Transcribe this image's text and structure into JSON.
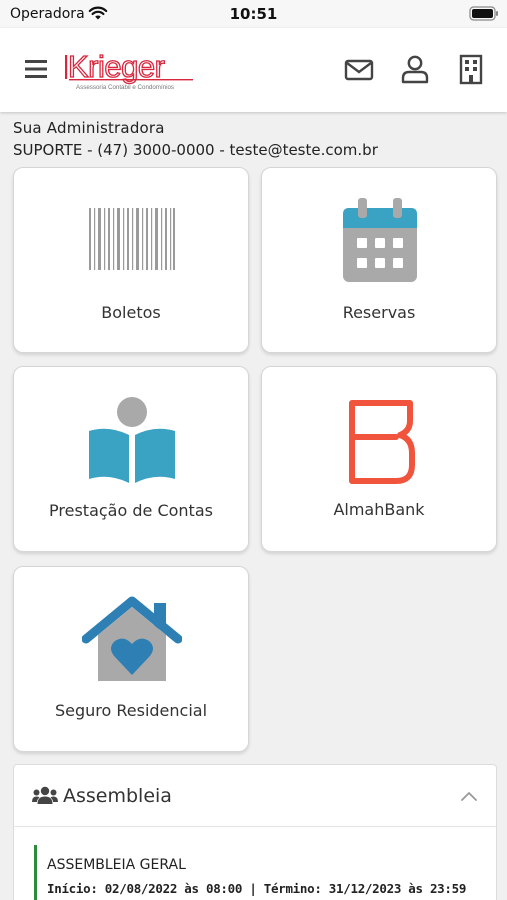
{
  "status_bar": {
    "carrier": "Operadora",
    "time": "10:51"
  },
  "header": {
    "logo_text": "Krieger",
    "logo_tagline": "Assessoria Contábil e Condomínios",
    "icons": [
      "menu-icon",
      "mail-icon",
      "user-icon",
      "building-icon"
    ],
    "brand_color": "#d7263d"
  },
  "admin": {
    "title": "Sua Administradora",
    "contact": "SUPORTE - (47) 3000-0000 - teste@teste.com.br"
  },
  "cards": [
    {
      "label": "Boletos",
      "icon": "barcode-icon"
    },
    {
      "label": "Reservas",
      "icon": "calendar-icon"
    },
    {
      "label": "Prestação de Contas",
      "icon": "book-reader-icon"
    },
    {
      "label": "AlmahBank",
      "icon": "almahbank-logo-icon"
    },
    {
      "label": "Seguro Residencial",
      "icon": "house-heart-icon"
    }
  ],
  "assembleia": {
    "title": "Assembleia",
    "icon": "users-icon",
    "items": [
      {
        "title": "ASSEMBLEIA GERAL",
        "dates": "Início: 02/08/2022 às 08:00 | Término: 31/12/2023 às 23:59"
      }
    ]
  },
  "colors": {
    "accent_teal": "#3aa3c4",
    "icon_gray": "#a9a9a9",
    "almah_red": "#f0543c",
    "house_blue": "#2e7fb3",
    "status_green": "#2e8b3e"
  }
}
